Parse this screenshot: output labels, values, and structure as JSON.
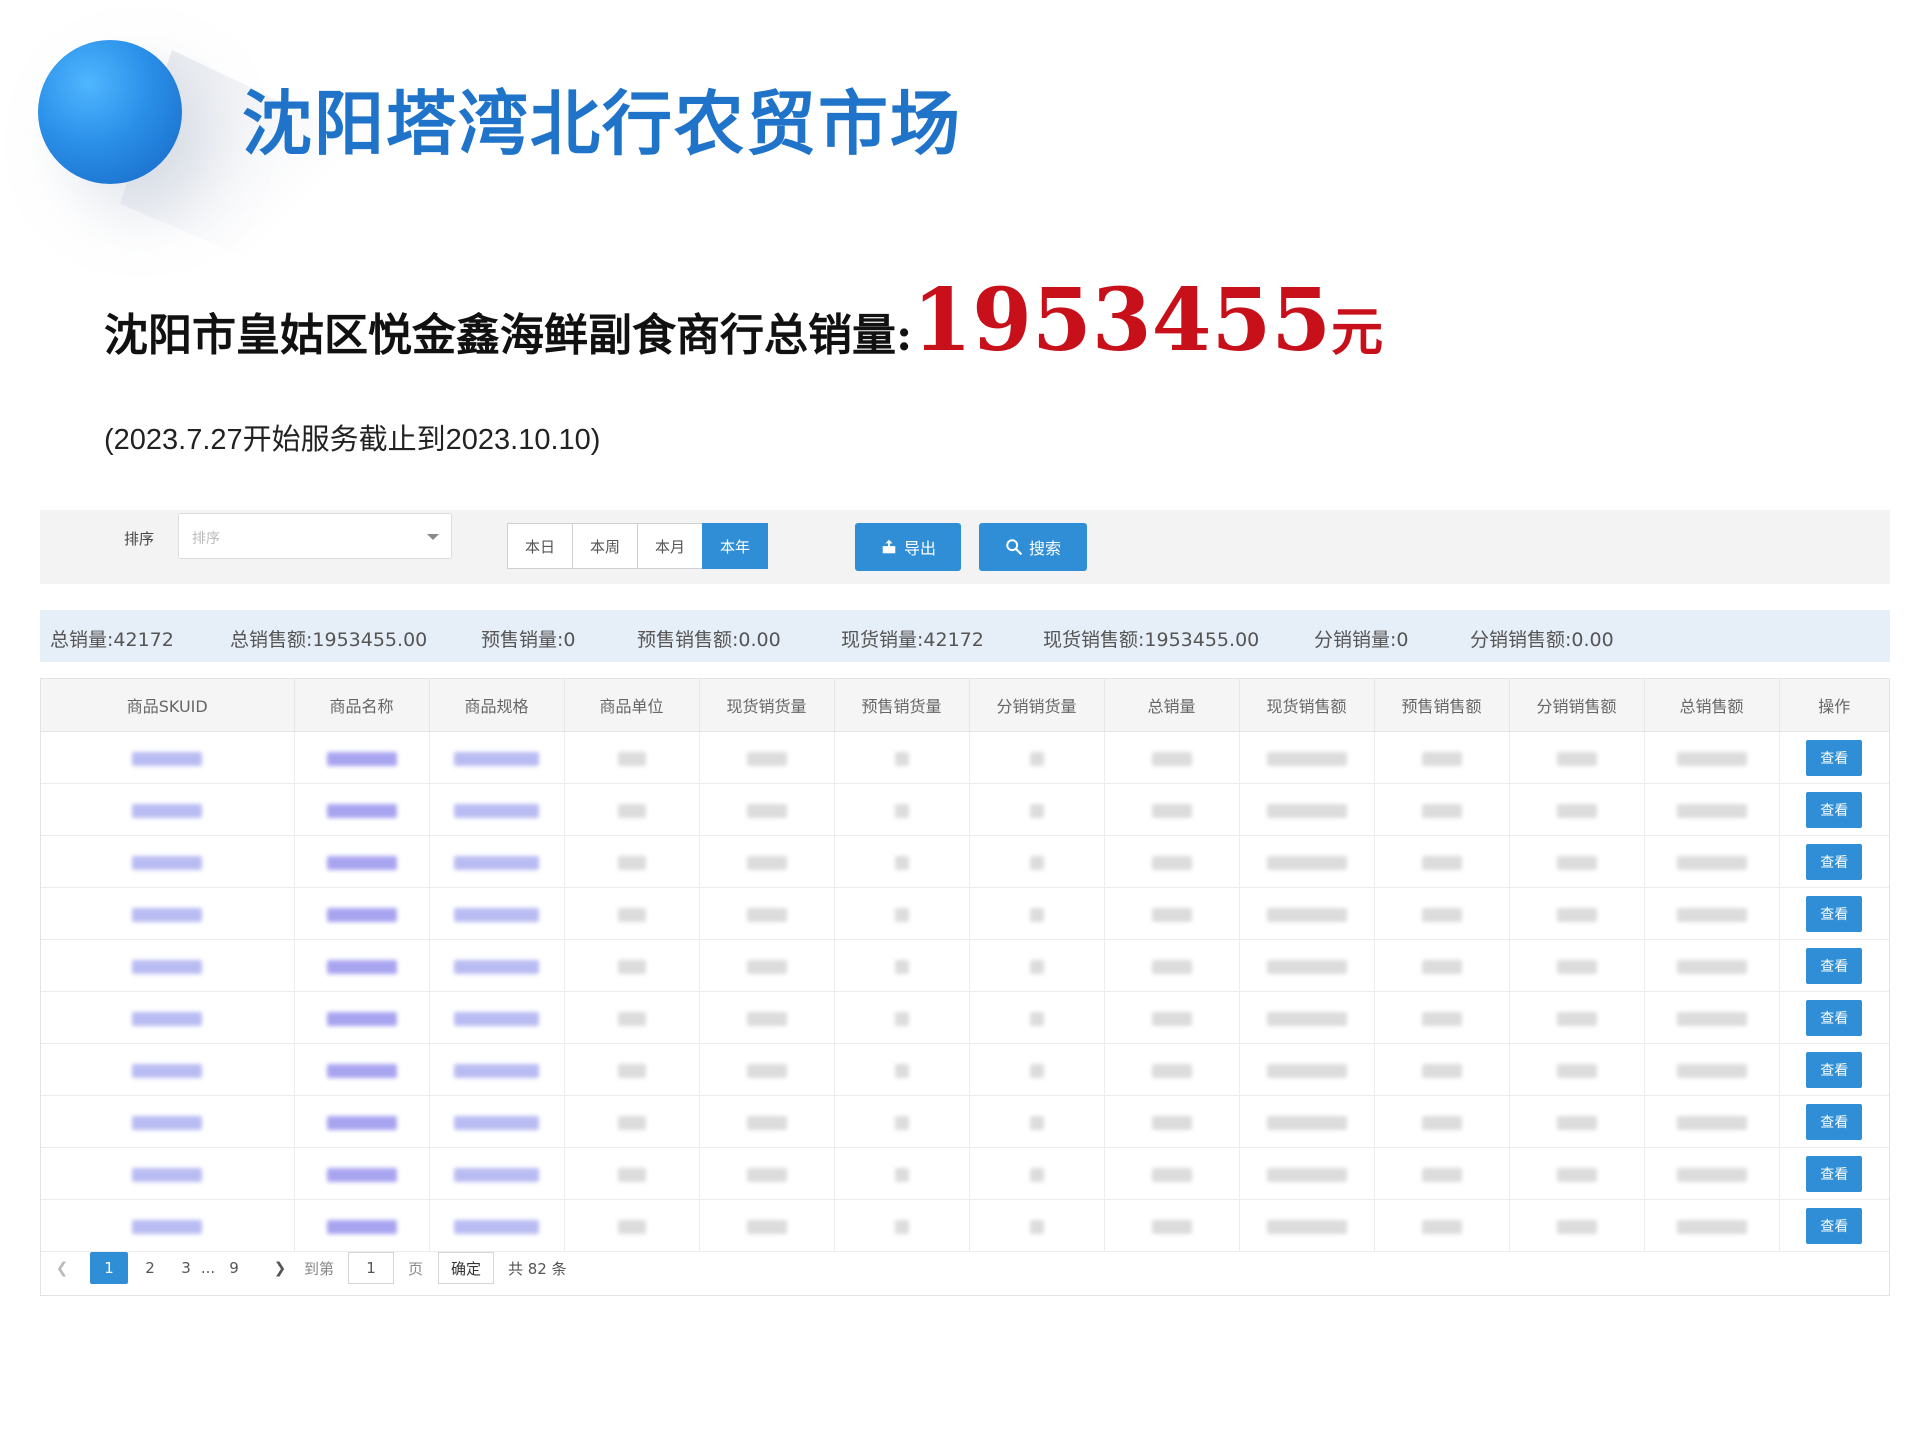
{
  "header": {
    "market_title": "沈阳塔湾北行农贸市场",
    "sales_label": "沈阳市皇姑区悦金鑫海鲜副食商行总销量:",
    "sales_value": "1953455",
    "sales_unit": "元",
    "period": "(2023.7.27开始服务截止到2023.10.10)"
  },
  "toolbar": {
    "sort_label": "排序",
    "sort_placeholder": "排序",
    "ranges": [
      "本日",
      "本周",
      "本月",
      "本年"
    ],
    "active_range": "本年",
    "export_label": "导出",
    "search_label": "搜索"
  },
  "summary": [
    {
      "label": "总销量:",
      "value": "42172"
    },
    {
      "label": "总销售额:",
      "value": "1953455.00"
    },
    {
      "label": "预售销量:",
      "value": "0"
    },
    {
      "label": "预售销售额:",
      "value": "0.00"
    },
    {
      "label": "现货销量:",
      "value": "42172"
    },
    {
      "label": "现货销售额:",
      "value": "1953455.00"
    },
    {
      "label": "分销销量:",
      "value": "0"
    },
    {
      "label": "分销销售额:",
      "value": "0.00"
    }
  ],
  "table": {
    "columns": [
      "商品SKUID",
      "商品名称",
      "商品规格",
      "商品单位",
      "现货销货量",
      "预售销货量",
      "分销销货量",
      "总销量",
      "现货销售额",
      "预售销售额",
      "分销销售额",
      "总销售额",
      "操作"
    ],
    "row_action_label": "查看",
    "row_count": 10
  },
  "pagination": {
    "pages": [
      "1",
      "2",
      "3",
      "...",
      "9"
    ],
    "current_page": "1",
    "goto_label": "到第",
    "goto_value": "1",
    "page_unit": "页",
    "confirm_label": "确定",
    "total_label": "共 82 条"
  },
  "colors": {
    "accent": "#2f8ed6",
    "title_blue": "#1f73c9",
    "sales_red": "#c8101a"
  }
}
